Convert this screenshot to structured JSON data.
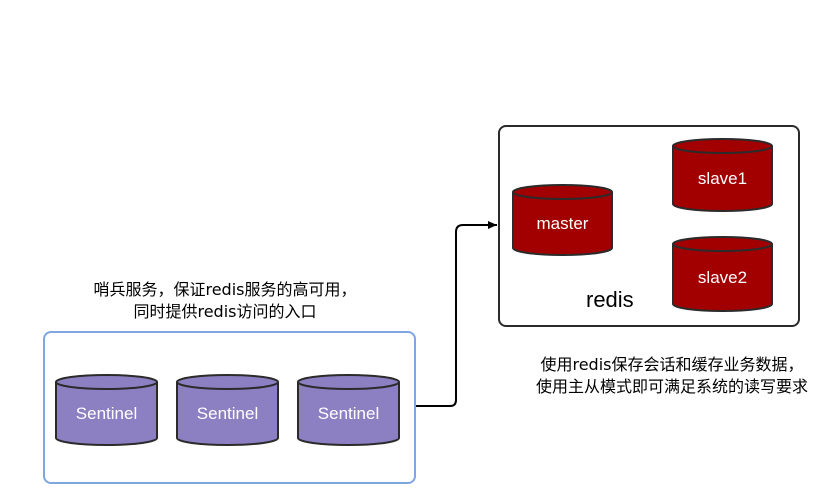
{
  "redis_group": {
    "label": "redis",
    "master": "master",
    "slaves": [
      "slave1",
      "slave2"
    ],
    "note": [
      "使用redis保存会话和缓存业务数据，",
      "使用主从模式即可满足系统的读写要求"
    ]
  },
  "sentinel_group": {
    "nodes": [
      "Sentinel",
      "Sentinel",
      "Sentinel"
    ],
    "note": [
      "哨兵服务，保证redis服务的高可用，",
      "同时提供redis访问的入口"
    ]
  },
  "colors": {
    "redis_fill": "#a20000",
    "sentinel_fill": "#8c7fc2",
    "sentinel_border": "#7ea6e0",
    "stroke": "#2b2b2b"
  }
}
